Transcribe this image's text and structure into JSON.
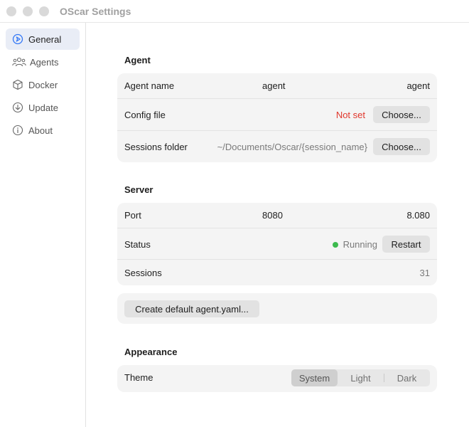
{
  "window": {
    "title": "OScar Settings"
  },
  "sidebar": {
    "items": [
      {
        "label": "General",
        "icon": "general-icon",
        "active": true
      },
      {
        "label": "Agents",
        "icon": "people-icon"
      },
      {
        "label": "Docker",
        "icon": "cube-icon"
      },
      {
        "label": "Update",
        "icon": "download-icon"
      },
      {
        "label": "About",
        "icon": "info-icon"
      }
    ]
  },
  "agent": {
    "section_title": "Agent",
    "name_label": "Agent name",
    "name_value": "agent",
    "name_value_right": "agent",
    "config_label": "Config file",
    "config_status": "Not set",
    "config_button": "Choose...",
    "sessions_label": "Sessions folder",
    "sessions_path": "~/Documents/Oscar/{session_name}",
    "sessions_button": "Choose..."
  },
  "server": {
    "section_title": "Server",
    "port_label": "Port",
    "port_value": "8080",
    "port_value_right": "8.080",
    "status_label": "Status",
    "status_value": "Running",
    "status_color": "#3cba4e",
    "restart_button": "Restart",
    "sessions_label": "Sessions",
    "sessions_count": "31"
  },
  "create_default_button": "Create default agent.yaml...",
  "appearance": {
    "section_title": "Appearance",
    "theme_label": "Theme",
    "theme_options": [
      "System",
      "Light",
      "Dark"
    ],
    "theme_selected": "System"
  },
  "colors": {
    "warning": "#e0372c",
    "accent": "#3478f6"
  }
}
